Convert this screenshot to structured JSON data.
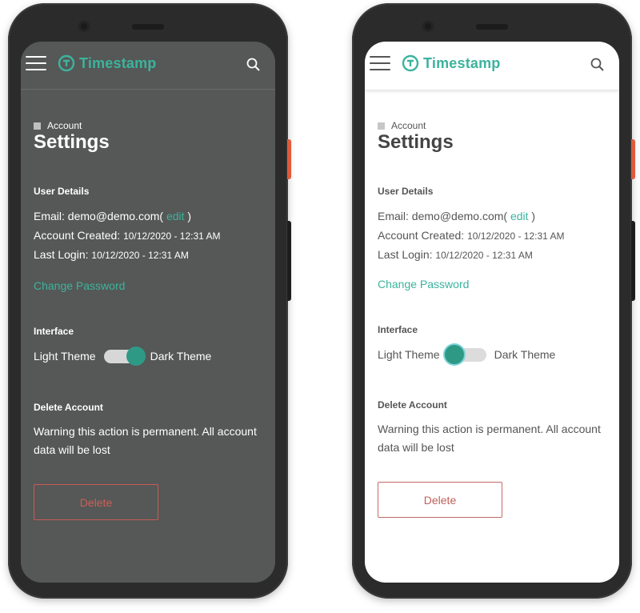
{
  "app": {
    "brand": "Timestamp"
  },
  "colors": {
    "accent": "#3cb39e",
    "danger": "#d05e57",
    "dark_bg": "#555856",
    "light_bg": "#ffffff"
  },
  "icons": {
    "menu": "hamburger-icon",
    "logo": "timestamp-logo-icon",
    "search": "search-icon",
    "breadcrumb": "square-icon"
  },
  "settings": {
    "breadcrumb": "Account",
    "title": "Settings",
    "user_details": {
      "heading": "User Details",
      "email_label": "Email:",
      "email_value": "demo@demo.com(",
      "edit_label": "edit",
      "email_close": ")",
      "created_label": "Account Created:",
      "created_value": "10/12/2020 - 12:31 AM",
      "login_label": "Last Login:",
      "login_value": "10/12/2020 - 12:31 AM"
    },
    "change_password": "Change Password",
    "interface": {
      "heading": "Interface",
      "light_label": "Light Theme",
      "dark_label": "Dark Theme"
    },
    "delete_account": {
      "heading": "Delete Account",
      "warning": "Warning this action is permanent. All account data will be lost",
      "button": "Delete"
    }
  },
  "screens": [
    {
      "theme": "dark",
      "dark_theme_enabled": true
    },
    {
      "theme": "light",
      "dark_theme_enabled": false
    }
  ]
}
